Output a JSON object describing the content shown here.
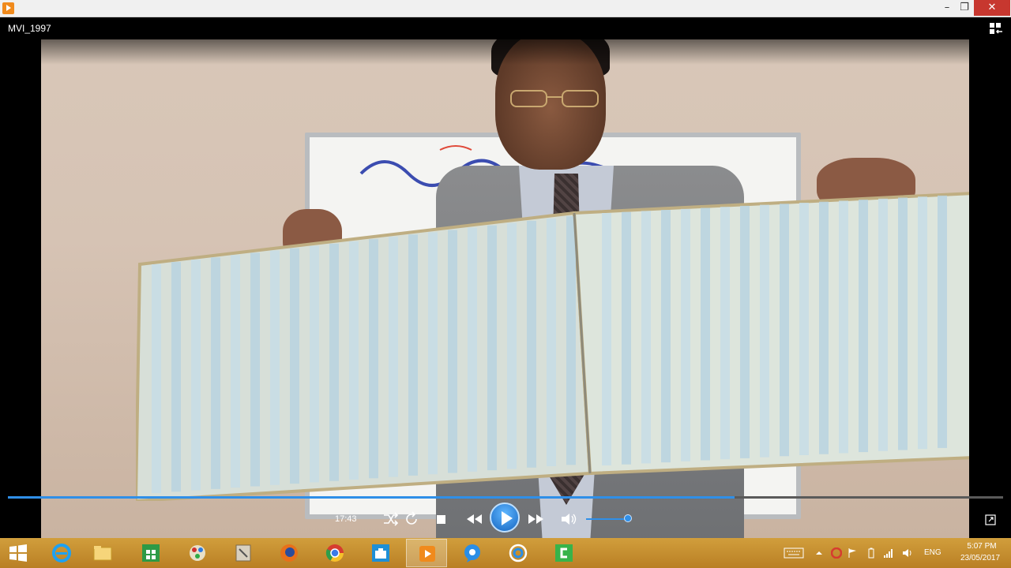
{
  "window": {
    "title_icon": "media-player-icon",
    "controls": {
      "minimize": "–",
      "maximize": "❐",
      "close": "✕"
    }
  },
  "player": {
    "video_title": "MVI_1997",
    "current_time": "17:43",
    "progress_fraction": 0.73,
    "volume_fraction": 0.95,
    "colors": {
      "accent": "#2f8fe8",
      "play": "#1e7be0"
    }
  },
  "taskbar": {
    "apps": [
      {
        "name": "start",
        "icon": "windows-logo-icon",
        "active": false
      },
      {
        "name": "internet-explorer",
        "icon": "ie-icon",
        "active": false
      },
      {
        "name": "file-explorer",
        "icon": "folder-icon",
        "active": false
      },
      {
        "name": "store",
        "icon": "store-icon",
        "active": false
      },
      {
        "name": "paint",
        "icon": "paint-icon",
        "active": false
      },
      {
        "name": "tool",
        "icon": "tool-icon",
        "active": false
      },
      {
        "name": "firefox",
        "icon": "firefox-icon",
        "active": false
      },
      {
        "name": "chrome",
        "icon": "chrome-icon",
        "active": false
      },
      {
        "name": "briefcase",
        "icon": "briefcase-icon",
        "active": false
      },
      {
        "name": "media-player",
        "icon": "media-player-icon",
        "active": true
      },
      {
        "name": "chat",
        "icon": "chat-bubble-icon",
        "active": false
      },
      {
        "name": "link",
        "icon": "link-icon",
        "active": false
      },
      {
        "name": "camtasia",
        "icon": "camtasia-icon",
        "active": false
      }
    ],
    "language": "ENG",
    "clock": {
      "time": "5:07 PM",
      "date": "23/05/2017"
    },
    "colors": {
      "taskbar": "#c48a2e"
    }
  }
}
